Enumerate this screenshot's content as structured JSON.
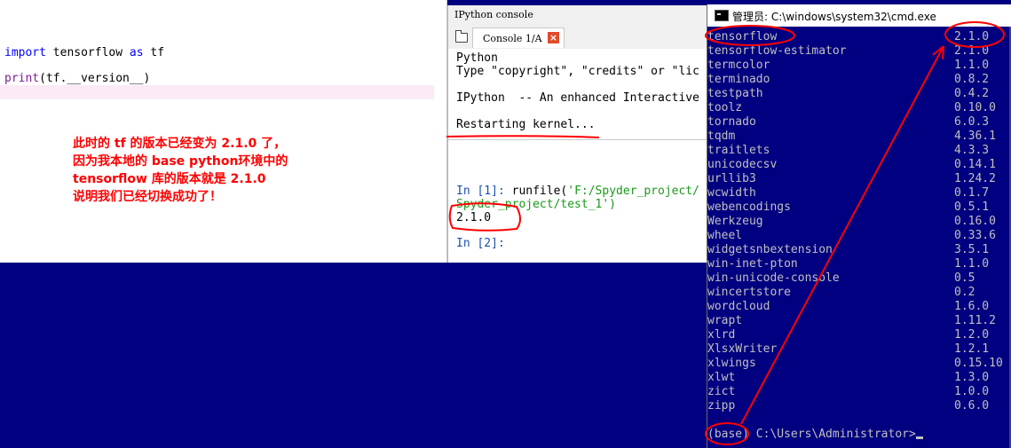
{
  "editor": {
    "line1": {
      "kw1": "import",
      "mid": " tensorflow ",
      "kw2": "as",
      "end": " tf"
    },
    "line2": {
      "fn": "print",
      "rest": "(tf.__version__)"
    },
    "annotation": [
      "此时的 tf 的版本已经变为 2.1.0 了，",
      "因为我本地的 base python环境中的",
      "tensorflow 库的版本就是 2.1.0",
      "说明我们已经切换成功了！"
    ]
  },
  "ipython": {
    "pane_title": "IPython console",
    "tab_label": "Console 1/A",
    "tab_close": "×",
    "banner_1": "Python",
    "banner_2": "Type \"copyright\", \"credits\" or \"lic",
    "banner_3": "IPython  -- An enhanced Interactive",
    "restart": "Restarting kernel...",
    "in1_prompt": "In [1]:",
    "in1_cmd": " runfile(",
    "in1_str": "'F:/Spyder_project/",
    "in1_cont": "Spyder_project/test_1')",
    "out1": "2.1.0",
    "in2_prompt": "In [2]:"
  },
  "cmd": {
    "title": "管理员: C:\\windows\\system32\\cmd.exe",
    "packages": [
      {
        "name": "tensorflow",
        "version": "2.1.0"
      },
      {
        "name": "tensorflow-estimator",
        "version": "2.1.0"
      },
      {
        "name": "termcolor",
        "version": "1.1.0"
      },
      {
        "name": "terminado",
        "version": "0.8.2"
      },
      {
        "name": "testpath",
        "version": "0.4.2"
      },
      {
        "name": "toolz",
        "version": "0.10.0"
      },
      {
        "name": "tornado",
        "version": "6.0.3"
      },
      {
        "name": "tqdm",
        "version": "4.36.1"
      },
      {
        "name": "traitlets",
        "version": "4.3.3"
      },
      {
        "name": "unicodecsv",
        "version": "0.14.1"
      },
      {
        "name": "urllib3",
        "version": "1.24.2"
      },
      {
        "name": "wcwidth",
        "version": "0.1.7"
      },
      {
        "name": "webencodings",
        "version": "0.5.1"
      },
      {
        "name": "Werkzeug",
        "version": "0.16.0"
      },
      {
        "name": "wheel",
        "version": "0.33.6"
      },
      {
        "name": "widgetsnbextension",
        "version": "3.5.1"
      },
      {
        "name": "win-inet-pton",
        "version": "1.1.0"
      },
      {
        "name": "win-unicode-console",
        "version": "0.5"
      },
      {
        "name": "wincertstore",
        "version": "0.2"
      },
      {
        "name": "wordcloud",
        "version": "1.6.0"
      },
      {
        "name": "wrapt",
        "version": "1.11.2"
      },
      {
        "name": "xlrd",
        "version": "1.2.0"
      },
      {
        "name": "XlsxWriter",
        "version": "1.2.1"
      },
      {
        "name": "xlwings",
        "version": "0.15.10"
      },
      {
        "name": "xlwt",
        "version": "1.3.0"
      },
      {
        "name": "zict",
        "version": "1.0.0"
      },
      {
        "name": "zipp",
        "version": "0.6.0"
      }
    ],
    "prompt": "(base) C:\\Users\\Administrator>"
  },
  "colors": {
    "annotation": "#ff0000",
    "cmd_background": "#000080",
    "cmd_text": "#c0c0c0"
  }
}
